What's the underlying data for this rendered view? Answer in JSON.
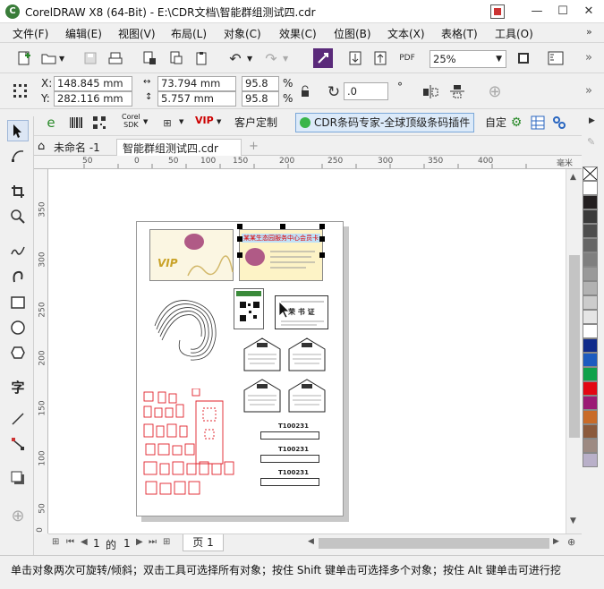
{
  "window": {
    "title": "CorelDRAW X8 (64-Bit) - E:\\CDR文档\\智能群组测试四.cdr",
    "app_icon": "coreldraw-logo-icon"
  },
  "menu": [
    {
      "label": "文件(F)"
    },
    {
      "label": "编辑(E)"
    },
    {
      "label": "视图(V)"
    },
    {
      "label": "布局(L)"
    },
    {
      "label": "对象(C)"
    },
    {
      "label": "效果(C)"
    },
    {
      "label": "位图(B)"
    },
    {
      "label": "文本(X)"
    },
    {
      "label": "表格(T)"
    },
    {
      "label": "工具(O)"
    }
  ],
  "toolbar": {
    "zoom_value": "25%",
    "pdf_label": "PDF"
  },
  "property_bar": {
    "x_label": "X:",
    "x_value": "148.845 mm",
    "y_label": "Y:",
    "y_value": "282.116 mm",
    "w_value": "73.794 mm",
    "h_value": "5.757 mm",
    "scale_w": "95.8",
    "scale_h": "95.8",
    "percent": "%",
    "rotation": ".0",
    "degree": "°"
  },
  "plugin_bar": {
    "btn_corel_sdk_1": "Corel",
    "btn_corel_sdk_2": "SDK",
    "btn_vip": "VIP",
    "btn_custom": "客户定制",
    "plugin_label": "CDR条码专家-全球顶级条码插件",
    "btn_adjust": "自定"
  },
  "tabs": {
    "welcome": "未命名 -1",
    "doc": "智能群组测试四.cdr",
    "add": "+"
  },
  "ruler": {
    "h_ticks": [
      "50",
      "0",
      "50",
      "100",
      "150",
      "200",
      "250",
      "300",
      "350",
      "400"
    ],
    "h_unit": "毫米",
    "v_ticks": [
      "350",
      "300",
      "250",
      "200",
      "150",
      "100",
      "50",
      "0"
    ]
  },
  "canvas": {
    "card1_text": "VIP",
    "card2_text": "某某生态园服务中心会员卡",
    "cert_title": "荣 书 证",
    "barcodes": [
      "T100231",
      "T100231",
      "T100231"
    ]
  },
  "navigator": {
    "current": "1",
    "of_label": "的",
    "total": "1",
    "page_tab": "页 1"
  },
  "status": {
    "text": "单击对象两次可旋转/倾斜；双击工具可选择所有对象；按住 Shift 键单击可选择多个对象；按住 Alt 键单击可进行挖"
  },
  "palette": [
    "#ffffff",
    "#231f20",
    "#3a3a3a",
    "#4d4d4d",
    "#666666",
    "#7f7f7f",
    "#999999",
    "#b2b2b2",
    "#cccccc",
    "#e5e5e5",
    "#ffffff",
    "#0f2a8a",
    "#1c5bbf",
    "#0fa14a",
    "#e30613",
    "#9b1b75",
    "#c96b28",
    "#8b5a3c",
    "#9d8a82",
    "#b9b0c9"
  ],
  "colors": {
    "accent": "#3a7d3a",
    "selection": "#000000",
    "plugin_bg": "#dceaf9",
    "red_outline": "#e0202a"
  }
}
